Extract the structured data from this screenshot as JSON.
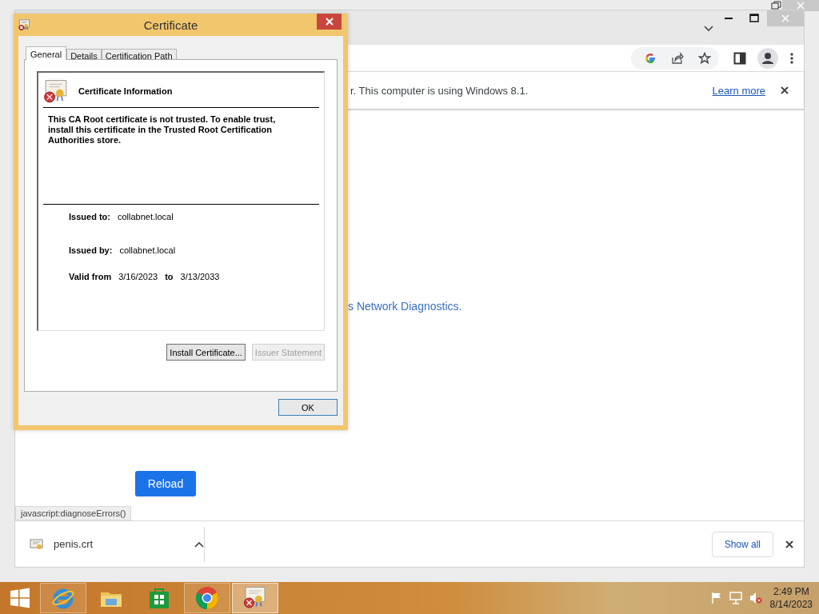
{
  "browser": {
    "infobar": {
      "message": "r. This computer is using Windows 8.1.",
      "link": "Learn more"
    },
    "content": {
      "link": "s Network Diagnostics.",
      "reload_button": "Reload"
    },
    "status_url": "javascript:diagnoseErrors()",
    "downloads": {
      "items": [
        {
          "filename": "penis.crt"
        }
      ],
      "show_all": "Show all"
    }
  },
  "dialog": {
    "title": "Certificate",
    "tabs": [
      {
        "label": "General",
        "selected": true
      },
      {
        "label": "Details",
        "selected": false
      },
      {
        "label": "Certification Path",
        "selected": false
      }
    ],
    "heading": "Certificate Information",
    "message": "This CA Root certificate is not trusted. To enable trust, install this certificate in the Trusted Root Certification Authorities store.",
    "fields": [
      {
        "label": "Issued to:",
        "value": "collabnet.local"
      },
      {
        "label": "Issued by:",
        "value": "collabnet.local"
      }
    ],
    "validity": {
      "from_label": "Valid from",
      "from": "3/16/2023",
      "to_label": "to",
      "to": "3/13/2033"
    },
    "buttons": [
      {
        "label": "Install Certificate...",
        "disabled": false
      },
      {
        "label": "Issuer Statement",
        "disabled": true
      }
    ],
    "ok_button": "OK"
  },
  "taskbar": {
    "apps": [
      {
        "kind": "ie",
        "running": true,
        "selected": false
      },
      {
        "kind": "explorer",
        "running": false,
        "selected": false
      },
      {
        "kind": "store",
        "running": false,
        "selected": false
      },
      {
        "kind": "chrome",
        "running": true,
        "selected": false
      },
      {
        "kind": "certificate",
        "running": true,
        "selected": true
      }
    ],
    "clock": {
      "time": "2:49 PM",
      "date": "8/14/2023"
    }
  }
}
